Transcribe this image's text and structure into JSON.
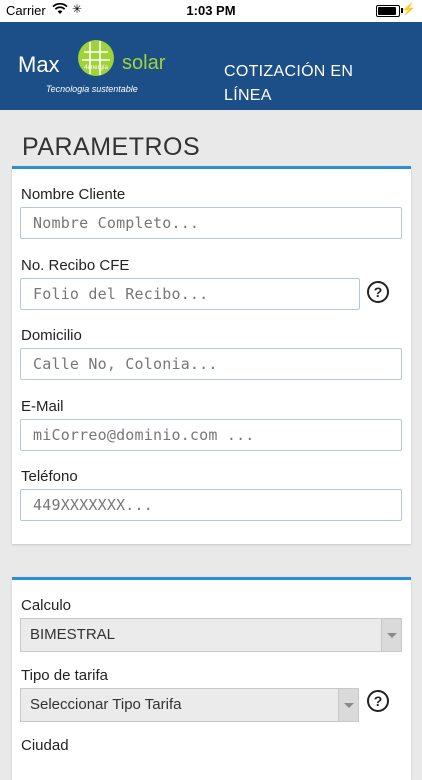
{
  "status_bar": {
    "carrier": "Carrier",
    "time": "1:03 PM",
    "activity": "✳"
  },
  "header": {
    "brand_left": "Max",
    "brand_badge": "4energía",
    "brand_right": "solar",
    "tagline": "Tecnologia sustentable",
    "title": "COTIZACIÓN EN LÍNEA"
  },
  "parametros": {
    "heading": "PARAMETROS",
    "fields": [
      {
        "label": "Nombre Cliente",
        "placeholder": "Nombre Completo..."
      },
      {
        "label": "No. Recibo CFE",
        "placeholder": "Folio del Recibo...",
        "help": "?"
      },
      {
        "label": "Domicilio",
        "placeholder": "Calle No, Colonia..."
      },
      {
        "label": "E-Mail",
        "placeholder": "miCorreo@dominio.com ..."
      },
      {
        "label": "Teléfono",
        "placeholder": "449XXXXXXX..."
      }
    ]
  },
  "calculo": {
    "fields": [
      {
        "label": "Calculo",
        "value": "BIMESTRAL"
      },
      {
        "label": "Tipo de tarifa",
        "value": "Seleccionar Tipo Tarifa",
        "help": "?"
      },
      {
        "label": "Ciudad"
      }
    ]
  }
}
